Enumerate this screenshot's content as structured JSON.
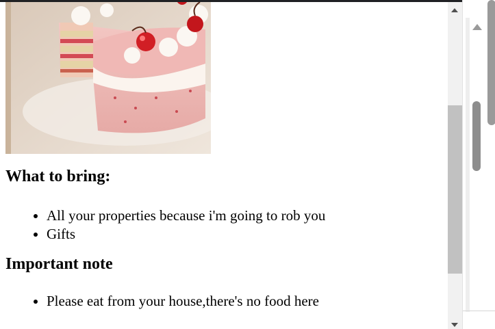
{
  "image": {
    "alt": "Pink cake with cherries"
  },
  "sections": [
    {
      "heading": "What to bring:",
      "items": [
        "All your properties because i'm going to rob you",
        "Gifts"
      ]
    },
    {
      "heading": "Important note",
      "items": [
        "Please eat from your house,there's no food here"
      ]
    }
  ],
  "colors": {
    "topbar": "#202124",
    "scroll_track": "#f1f1f1",
    "scroll_thumb": "#c1c1c1"
  },
  "icons": [
    "scroll-up-arrow-icon",
    "scroll-down-arrow-icon"
  ]
}
